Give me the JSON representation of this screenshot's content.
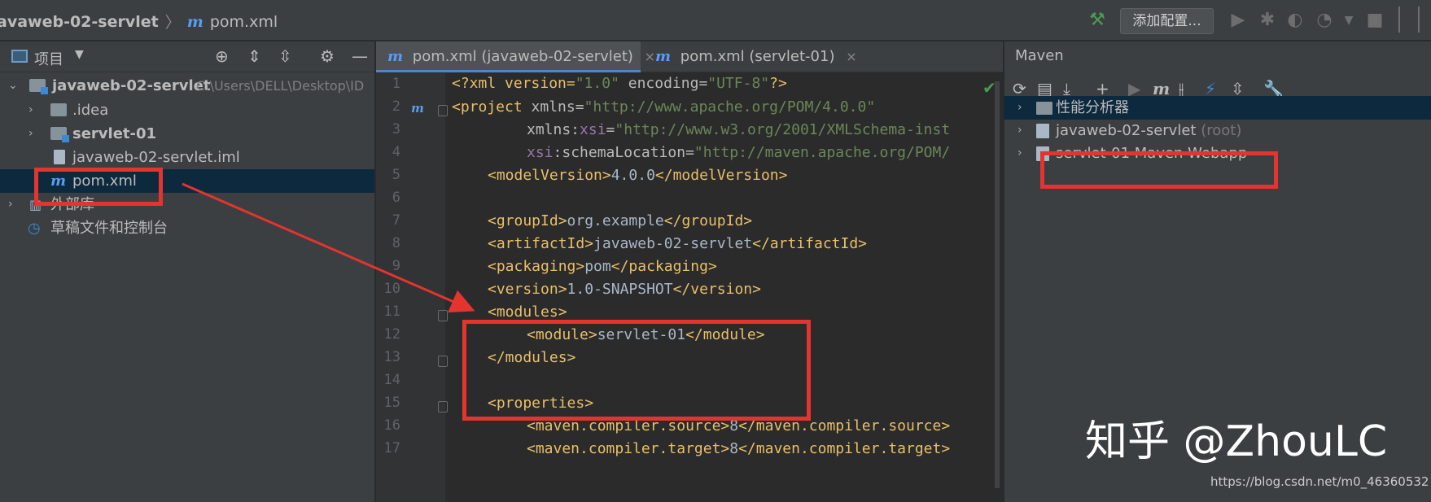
{
  "breadcrumb": {
    "project": "avaweb-02-servlet",
    "file": "pom.xml",
    "m_glyph": "m"
  },
  "toolbar": {
    "run_config_label": "添加配置...",
    "icons": [
      "hammer-icon",
      "run-icon",
      "debug-icon",
      "coverage-icon",
      "profile-icon",
      "stop-icon"
    ]
  },
  "project_panel": {
    "title": "项目",
    "tree": [
      {
        "label": "javaweb-02-servlet",
        "path": "C:\\Users\\DELL\\Desktop\\ID"
      },
      {
        "label": ".idea"
      },
      {
        "label": "servlet-01"
      },
      {
        "label": "javaweb-02-servlet.iml"
      },
      {
        "label": "pom.xml"
      },
      {
        "label": "外部库"
      },
      {
        "label": "草稿文件和控制台"
      }
    ]
  },
  "editor": {
    "tabs": [
      {
        "label": "pom.xml (javaweb-02-servlet)",
        "close": "×"
      },
      {
        "label": "pom.xml (servlet-01)",
        "close": "×"
      }
    ],
    "line_numbers": [
      "1",
      "2",
      "3",
      "4",
      "5",
      "6",
      "7",
      "8",
      "9",
      "10",
      "11",
      "12",
      "13",
      "14",
      "15",
      "16",
      "17"
    ],
    "lines": {
      "l1": {
        "a": "<?xml version=",
        "b": "\"1.0\"",
        "c": " encoding=",
        "d": "\"UTF-8\"",
        "e": "?>"
      },
      "l2": {
        "a": "<project ",
        "b": "xmlns=",
        "c": "\"http://www.apache.org/POM/4.0.0\""
      },
      "l3": {
        "a": "xmlns:",
        "b": "xsi",
        "c": "=",
        "d": "\"http://www.w3.org/2001/XMLSchema-inst"
      },
      "l4": {
        "a": "xsi",
        "b": ":schemaLocation=",
        "c": "\"http://maven.apache.org/POM/"
      },
      "l5": {
        "a": "<modelVersion>",
        "b": "4.0.0",
        "c": "</modelVersion>"
      },
      "l7": {
        "a": "<groupId>",
        "b": "org.example",
        "c": "</groupId>"
      },
      "l8": {
        "a": "<artifactId>",
        "b": "javaweb-02-servlet",
        "c": "</artifactId>"
      },
      "l9": {
        "a": "<packaging>",
        "b": "pom",
        "c": "</packaging>"
      },
      "l10": {
        "a": "<version>",
        "b": "1.0-SNAPSHOT",
        "c": "</version>"
      },
      "l11": {
        "a": "<modules>"
      },
      "l12": {
        "a": "<module>",
        "b": "servlet-01",
        "c": "</module>"
      },
      "l13": {
        "a": "</modules>"
      },
      "l15": {
        "a": "<properties>"
      },
      "l16": {
        "a": "<maven.compiler.source>",
        "b": "8",
        "c": "</maven.compiler.source>"
      },
      "l17": {
        "a": "<maven.compiler.target>",
        "b": "8",
        "c": "</maven.compiler.target>"
      }
    }
  },
  "maven_panel": {
    "title": "Maven",
    "tree": [
      {
        "label": "性能分析器"
      },
      {
        "label": "javaweb-02-servlet",
        "suffix": "(root)"
      },
      {
        "label": "servlet-01 Maven Webapp"
      }
    ]
  },
  "watermark": {
    "text": "知乎 @ZhouLC",
    "url": "https://blog.csdn.net/m0_46360532"
  },
  "colors": {
    "annotation_red": "#e3342f",
    "accent_blue": "#589df6",
    "selection": "#0d293e"
  }
}
